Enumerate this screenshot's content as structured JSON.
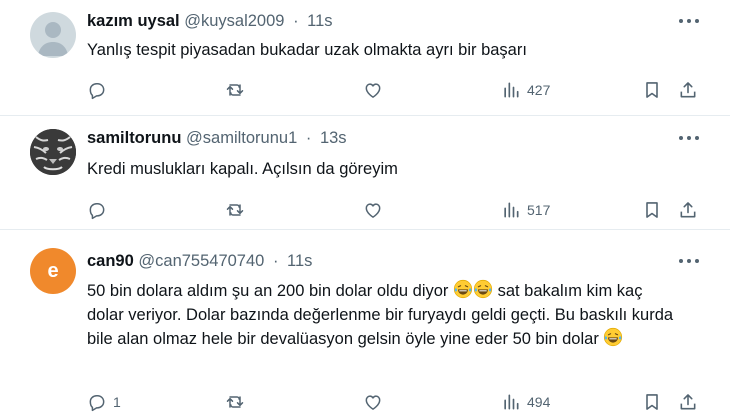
{
  "tweets": [
    {
      "name": "kazım uysal",
      "handle": "@kuysal2009",
      "time": "11s",
      "text": "Yanlış tespit piyasadan bukadar uzak olmakta ayrı bir başarı",
      "replies": "",
      "retweets": "",
      "likes": "",
      "views": "427"
    },
    {
      "name": "samiltorunu",
      "handle": "@samiltorunu1",
      "time": "13s",
      "text": "Kredi muslukları kapalı. Açılsın da göreyim",
      "replies": "",
      "retweets": "",
      "likes": "",
      "views": "517"
    },
    {
      "name": "can90",
      "handle": "@can755470740",
      "time": "11s",
      "avatar_letter": "e",
      "text_parts": {
        "a": "50 bin dolara aldım şu an 200 bin dolar oldu diyor ",
        "b": " sat bakalım kim kaç dolar veriyor. Dolar bazında değerlenme bir furyaydı geldi geçti. Bu baskılı kurda bile alan olmaz hele bir devalüasyon gelsin öyle yine eder 50 bin dolar "
      },
      "replies": "1",
      "retweets": "",
      "likes": "",
      "views": "494"
    }
  ],
  "colors": {
    "text": "#0f1419",
    "secondary": "#536471",
    "divider": "#e6ecf0",
    "avatar_letter_bg": "#f0892c",
    "default_avatar_bg": "#cfd9de"
  },
  "icons": [
    "reply-icon",
    "retweet-icon",
    "like-icon",
    "views-icon",
    "bookmark-icon",
    "share-icon",
    "more-icon",
    "laughing-emoji"
  ]
}
